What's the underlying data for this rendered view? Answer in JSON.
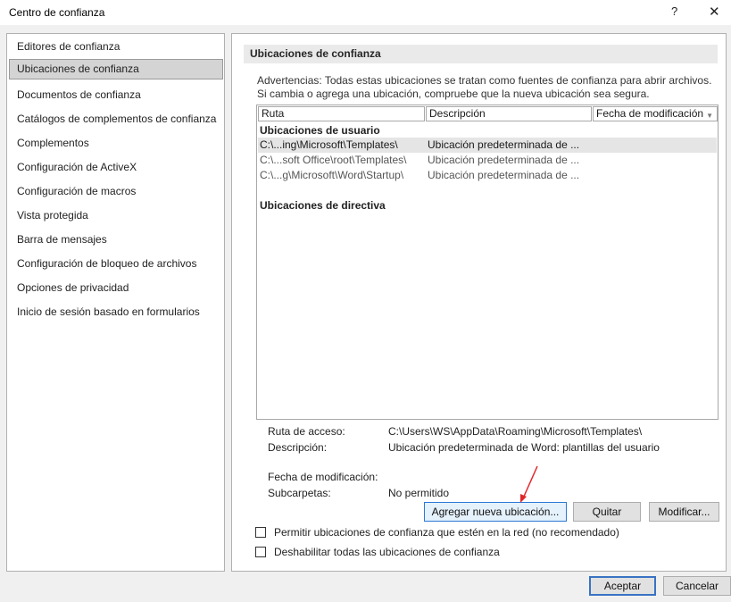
{
  "window": {
    "title": "Centro de confianza",
    "help_label": "?",
    "close_label": "✕"
  },
  "sidebar": {
    "items": [
      {
        "label": "Editores de confianza"
      },
      {
        "label": "Ubicaciones de confianza",
        "selected": true
      },
      {
        "label": "Documentos de confianza"
      },
      {
        "label": "Catálogos de complementos de confianza"
      },
      {
        "label": "Complementos"
      },
      {
        "label": "Configuración de ActiveX"
      },
      {
        "label": "Configuración de macros"
      },
      {
        "label": "Vista protegida"
      },
      {
        "label": "Barra de mensajes"
      },
      {
        "label": "Configuración de bloqueo de archivos"
      },
      {
        "label": "Opciones de privacidad"
      },
      {
        "label": "Inicio de sesión basado en formularios"
      }
    ]
  },
  "main": {
    "section_title": "Ubicaciones de confianza",
    "warning_text": "Advertencias: Todas estas ubicaciones se tratan como fuentes de confianza para abrir archivos. Si cambia o agrega una ubicación, compruebe que la nueva ubicación sea segura.",
    "columns": [
      "Ruta",
      "Descripción",
      "Fecha de modificación"
    ],
    "user_group_label": "Ubicaciones de usuario",
    "user_rows": [
      {
        "path": "C:\\...ing\\Microsoft\\Templates\\",
        "description": "Ubicación predeterminada de ...",
        "selected": true
      },
      {
        "path": "C:\\...soft Office\\root\\Templates\\",
        "description": "Ubicación predeterminada de ..."
      },
      {
        "path": "C:\\...g\\Microsoft\\Word\\Startup\\",
        "description": "Ubicación predeterminada de ..."
      }
    ],
    "policy_group_label": "Ubicaciones de directiva",
    "details": {
      "path_label": "Ruta de acceso:",
      "path_value": "C:\\Users\\WS\\AppData\\Roaming\\Microsoft\\Templates\\",
      "description_label": "Descripción:",
      "description_value": "Ubicación predeterminada de Word: plantillas del usuario",
      "modified_label": "Fecha de modificación:",
      "modified_value": "",
      "subfolders_label": "Subcarpetas:",
      "subfolders_value": "No permitido"
    },
    "buttons": {
      "add": "Agregar nueva ubicación...",
      "remove": "Quitar",
      "modify": "Modificar..."
    },
    "checkboxes": {
      "network": {
        "label": "Permitir ubicaciones de confianza que estén en la red (no recomendado)",
        "checked": false
      },
      "disable_all": {
        "label": "Deshabilitar todas las ubicaciones de confianza",
        "checked": false
      }
    }
  },
  "footer": {
    "ok": "Aceptar",
    "cancel": "Cancelar"
  },
  "colors": {
    "annotation_arrow": "#e0262b",
    "focus_border": "#2b79d6"
  }
}
